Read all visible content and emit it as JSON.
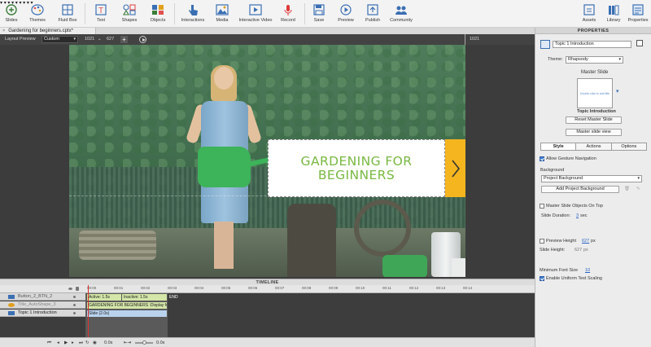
{
  "toolbar": {
    "items": [
      {
        "label": "Slides",
        "icon": "add-slide-icon"
      },
      {
        "label": "Themes",
        "icon": "palette-icon"
      },
      {
        "label": "Fluid Box",
        "icon": "fluid-box-icon"
      },
      {
        "label": "Text",
        "icon": "text-icon"
      },
      {
        "label": "Shapes",
        "icon": "shapes-icon"
      },
      {
        "label": "Objects",
        "icon": "objects-icon"
      },
      {
        "label": "Interactions",
        "icon": "hand-pointer-icon"
      },
      {
        "label": "Media",
        "icon": "image-icon"
      },
      {
        "label": "Interactive Video",
        "icon": "video-icon"
      },
      {
        "label": "Record",
        "icon": "microphone-icon"
      },
      {
        "label": "Save",
        "icon": "save-icon"
      },
      {
        "label": "Preview",
        "icon": "play-icon"
      },
      {
        "label": "Publish",
        "icon": "publish-icon"
      },
      {
        "label": "Community",
        "icon": "community-icon"
      },
      {
        "label": "Assets",
        "icon": "assets-icon"
      },
      {
        "label": "Library",
        "icon": "library-icon"
      },
      {
        "label": "Properties",
        "icon": "properties-icon"
      }
    ]
  },
  "document": {
    "tab_title": "Gardening for beginners.cptx*",
    "close_glyph": "×"
  },
  "layout_preview": {
    "label": "Layout Preview",
    "mode": "Custom",
    "width": "1021",
    "height": "627",
    "marker_value": "1021"
  },
  "slide": {
    "title": "GARDENING FOR\nBEGINNERS",
    "title_color": "#79b842",
    "next_button_color": "#f4b51e"
  },
  "timeline": {
    "header": "TIMELINE",
    "ruler_ticks": [
      "00:00",
      "00:01",
      "00:02",
      "00:03",
      "00:04",
      "00:05",
      "00:06",
      "00:07",
      "00:08",
      "00:09",
      "00:10",
      "00:11",
      "00:12",
      "00:13",
      "00:14"
    ],
    "layers": [
      {
        "name": "Button_2_BTN_2",
        "icon_color": "#3a6fb3",
        "bar_label": "Active: 1.5s",
        "bar_label_2": "Inactive: 1.5s",
        "bar_color": "#d4e6a8"
      },
      {
        "name": "Title_AutoShape_3",
        "icon_color": "#e0a020",
        "bar_label": "GARDENING FOR BEGINNERS :Display for ...",
        "bar_color": "#d4e6a8"
      },
      {
        "name": "Topic 1 Introduction",
        "icon_color": "#3a6fb3",
        "bar_label": "Slide (2.0s)",
        "bar_color": "#b9d3ee"
      }
    ],
    "end_label": "END",
    "bottom": {
      "time_a": "0.0s",
      "time_b": "0.0s",
      "time_c": "0.0s"
    }
  },
  "properties": {
    "header": "PROPERTIES",
    "slide_name": "Topic 1 Introduction",
    "theme_label": "Theme:",
    "theme_value": "Rhapsody",
    "master_slide_label": "Master Slide",
    "master_thumb_text": "Double-click to add title",
    "master_name": "Topic Introduction",
    "reset_master": "Reset Master Slide",
    "master_view": "Master slide view",
    "tabs": [
      "Style",
      "Actions",
      "Options"
    ],
    "active_tab": "Style",
    "allow_gesture": "Allow Gesture Navigation",
    "background_label": "Background",
    "background_value": "Project Background",
    "add_project_bg": "Add Project Background",
    "master_objects_on_top": "Master Slide Objects On Top",
    "slide_duration_label": "Slide Duration:",
    "slide_duration_value": "3",
    "slide_duration_unit": "sec",
    "preview_height_label": "Preview Height",
    "preview_height_value": "627",
    "preview_height_unit": "px",
    "slide_height_label": "Slide Height:",
    "slide_height_value": "627",
    "slide_height_unit": "px",
    "min_font_label": "Minimum Font Size",
    "min_font_value": "10",
    "uniform_scaling": "Enable Uniform Text Scaling"
  }
}
